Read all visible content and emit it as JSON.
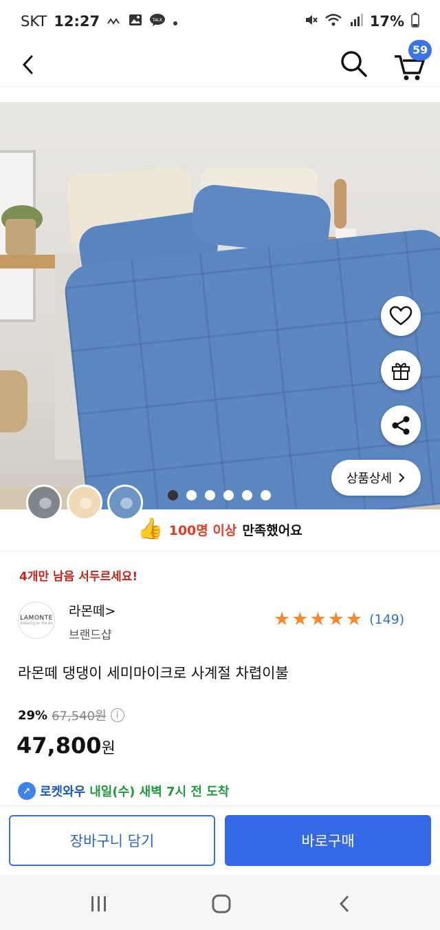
{
  "status_bar": {
    "carrier": "SKT",
    "time": "12:27",
    "battery": "17%",
    "icons": [
      "kakao-talk-icon",
      "image-icon",
      "chat-icon",
      "dot-icon",
      "mute-icon",
      "wifi-icon",
      "signal-icon",
      "battery-icon"
    ]
  },
  "nav": {
    "cart_count": "59",
    "icons": [
      "back-icon",
      "search-icon",
      "cart-icon"
    ]
  },
  "hero": {
    "detail_button": "상품상세",
    "slide_total": 6,
    "slide_active": 1,
    "swatches": 3
  },
  "satisfaction": {
    "highlight": "100명 이상",
    "rest": "만족했어요"
  },
  "stock_alert": "4개만 남음 서두르세요!",
  "brand": {
    "name": "라몬떼",
    "chevron": ">",
    "sub": "브랜드샵",
    "logo_text": "LAMONTE",
    "logo_sub": "Sleeping on the Air"
  },
  "rating": {
    "stars": 5,
    "count": "(149)"
  },
  "product": {
    "title": "라몬떼 댕댕이 세미마이크로 사계절 차렵이불"
  },
  "price": {
    "discount": "29%",
    "original": "67,540원",
    "final": "47,800",
    "won": "원"
  },
  "delivery": {
    "brand": "로켓와우",
    "message": "내일(수) 새벽 7시 전 도착"
  },
  "actions": {
    "cart_label": "장바구니 담기",
    "buy_label": "바로구매"
  },
  "colors": {
    "accent": "#3468e4",
    "star": "#f58a2c",
    "alert": "#c3251c",
    "delivery_green": "#1e9a3c"
  }
}
